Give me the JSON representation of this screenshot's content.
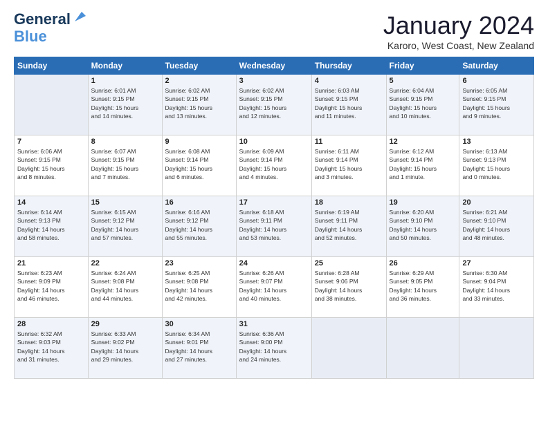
{
  "header": {
    "logo_line1": "General",
    "logo_line2": "Blue",
    "month_title": "January 2024",
    "subtitle": "Karoro, West Coast, New Zealand"
  },
  "weekdays": [
    "Sunday",
    "Monday",
    "Tuesday",
    "Wednesday",
    "Thursday",
    "Friday",
    "Saturday"
  ],
  "weeks": [
    [
      {
        "day": "",
        "info": ""
      },
      {
        "day": "1",
        "info": "Sunrise: 6:01 AM\nSunset: 9:15 PM\nDaylight: 15 hours\nand 14 minutes."
      },
      {
        "day": "2",
        "info": "Sunrise: 6:02 AM\nSunset: 9:15 PM\nDaylight: 15 hours\nand 13 minutes."
      },
      {
        "day": "3",
        "info": "Sunrise: 6:02 AM\nSunset: 9:15 PM\nDaylight: 15 hours\nand 12 minutes."
      },
      {
        "day": "4",
        "info": "Sunrise: 6:03 AM\nSunset: 9:15 PM\nDaylight: 15 hours\nand 11 minutes."
      },
      {
        "day": "5",
        "info": "Sunrise: 6:04 AM\nSunset: 9:15 PM\nDaylight: 15 hours\nand 10 minutes."
      },
      {
        "day": "6",
        "info": "Sunrise: 6:05 AM\nSunset: 9:15 PM\nDaylight: 15 hours\nand 9 minutes."
      }
    ],
    [
      {
        "day": "7",
        "info": "Sunrise: 6:06 AM\nSunset: 9:15 PM\nDaylight: 15 hours\nand 8 minutes."
      },
      {
        "day": "8",
        "info": "Sunrise: 6:07 AM\nSunset: 9:15 PM\nDaylight: 15 hours\nand 7 minutes."
      },
      {
        "day": "9",
        "info": "Sunrise: 6:08 AM\nSunset: 9:14 PM\nDaylight: 15 hours\nand 6 minutes."
      },
      {
        "day": "10",
        "info": "Sunrise: 6:09 AM\nSunset: 9:14 PM\nDaylight: 15 hours\nand 4 minutes."
      },
      {
        "day": "11",
        "info": "Sunrise: 6:11 AM\nSunset: 9:14 PM\nDaylight: 15 hours\nand 3 minutes."
      },
      {
        "day": "12",
        "info": "Sunrise: 6:12 AM\nSunset: 9:14 PM\nDaylight: 15 hours\nand 1 minute."
      },
      {
        "day": "13",
        "info": "Sunrise: 6:13 AM\nSunset: 9:13 PM\nDaylight: 15 hours\nand 0 minutes."
      }
    ],
    [
      {
        "day": "14",
        "info": "Sunrise: 6:14 AM\nSunset: 9:13 PM\nDaylight: 14 hours\nand 58 minutes."
      },
      {
        "day": "15",
        "info": "Sunrise: 6:15 AM\nSunset: 9:12 PM\nDaylight: 14 hours\nand 57 minutes."
      },
      {
        "day": "16",
        "info": "Sunrise: 6:16 AM\nSunset: 9:12 PM\nDaylight: 14 hours\nand 55 minutes."
      },
      {
        "day": "17",
        "info": "Sunrise: 6:18 AM\nSunset: 9:11 PM\nDaylight: 14 hours\nand 53 minutes."
      },
      {
        "day": "18",
        "info": "Sunrise: 6:19 AM\nSunset: 9:11 PM\nDaylight: 14 hours\nand 52 minutes."
      },
      {
        "day": "19",
        "info": "Sunrise: 6:20 AM\nSunset: 9:10 PM\nDaylight: 14 hours\nand 50 minutes."
      },
      {
        "day": "20",
        "info": "Sunrise: 6:21 AM\nSunset: 9:10 PM\nDaylight: 14 hours\nand 48 minutes."
      }
    ],
    [
      {
        "day": "21",
        "info": "Sunrise: 6:23 AM\nSunset: 9:09 PM\nDaylight: 14 hours\nand 46 minutes."
      },
      {
        "day": "22",
        "info": "Sunrise: 6:24 AM\nSunset: 9:08 PM\nDaylight: 14 hours\nand 44 minutes."
      },
      {
        "day": "23",
        "info": "Sunrise: 6:25 AM\nSunset: 9:08 PM\nDaylight: 14 hours\nand 42 minutes."
      },
      {
        "day": "24",
        "info": "Sunrise: 6:26 AM\nSunset: 9:07 PM\nDaylight: 14 hours\nand 40 minutes."
      },
      {
        "day": "25",
        "info": "Sunrise: 6:28 AM\nSunset: 9:06 PM\nDaylight: 14 hours\nand 38 minutes."
      },
      {
        "day": "26",
        "info": "Sunrise: 6:29 AM\nSunset: 9:05 PM\nDaylight: 14 hours\nand 36 minutes."
      },
      {
        "day": "27",
        "info": "Sunrise: 6:30 AM\nSunset: 9:04 PM\nDaylight: 14 hours\nand 33 minutes."
      }
    ],
    [
      {
        "day": "28",
        "info": "Sunrise: 6:32 AM\nSunset: 9:03 PM\nDaylight: 14 hours\nand 31 minutes."
      },
      {
        "day": "29",
        "info": "Sunrise: 6:33 AM\nSunset: 9:02 PM\nDaylight: 14 hours\nand 29 minutes."
      },
      {
        "day": "30",
        "info": "Sunrise: 6:34 AM\nSunset: 9:01 PM\nDaylight: 14 hours\nand 27 minutes."
      },
      {
        "day": "31",
        "info": "Sunrise: 6:36 AM\nSunset: 9:00 PM\nDaylight: 14 hours\nand 24 minutes."
      },
      {
        "day": "",
        "info": ""
      },
      {
        "day": "",
        "info": ""
      },
      {
        "day": "",
        "info": ""
      }
    ]
  ]
}
